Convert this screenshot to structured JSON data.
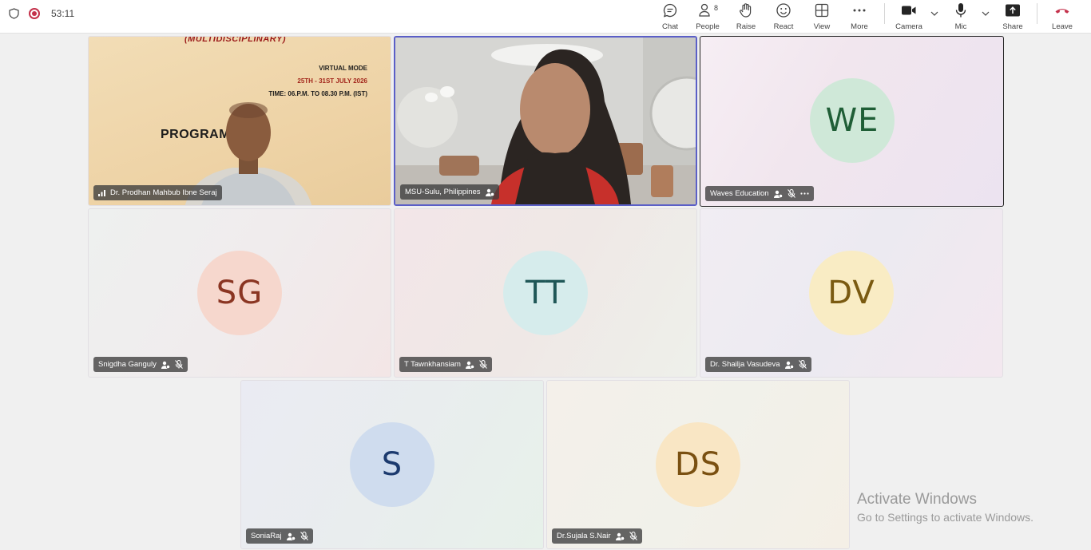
{
  "meeting": {
    "timer": "53:11"
  },
  "toolbar": {
    "chat": "Chat",
    "people": "People",
    "people_count": "8",
    "raise": "Raise",
    "react": "React",
    "view": "View",
    "more": "More",
    "camera": "Camera",
    "mic": "Mic",
    "share": "Share",
    "leave": "Leave"
  },
  "poster": {
    "header": "(MULTIDISCIPLINARY)",
    "mode": "VIRTUAL MODE",
    "dates": "25TH - 31ST JULY 2026",
    "time": "TIME: 06.P.M. TO 08.30 P.M. (IST)",
    "program": "PROGRAM        DULE"
  },
  "participants": [
    {
      "name": "Dr. Prodhan Mahbub Ibne Seraj"
    },
    {
      "name": "MSU-Sulu, Philippines"
    },
    {
      "name": "Waves Education",
      "initials": "WE",
      "avatar_bg": "#cfe8d8",
      "avatar_fg": "#1f5e36"
    },
    {
      "name": "Snigdha Ganguly",
      "initials": "SG",
      "avatar_bg": "#f6d7cd",
      "avatar_fg": "#8a3522"
    },
    {
      "name": "T Tawnkhansiam",
      "initials": "TT",
      "avatar_bg": "#d6ecec",
      "avatar_fg": "#1f5757"
    },
    {
      "name": "Dr. Shailja Vasudeva",
      "initials": "DV",
      "avatar_bg": "#f9ecc4",
      "avatar_fg": "#7a5a11"
    },
    {
      "name": "SoniaRaj",
      "initials": "S",
      "avatar_bg": "#cfdcee",
      "avatar_fg": "#1c3a6e"
    },
    {
      "name": "Dr.Sujala S.Nair",
      "initials": "DS",
      "avatar_bg": "#f9e6c4",
      "avatar_fg": "#7a5011"
    }
  ],
  "watermark": {
    "title": "Activate Windows",
    "subtitle": "Go to Settings to activate Windows."
  },
  "colors": {
    "accent": "#5b5fc7",
    "record": "#c4314b",
    "leave": "#c4314b"
  }
}
